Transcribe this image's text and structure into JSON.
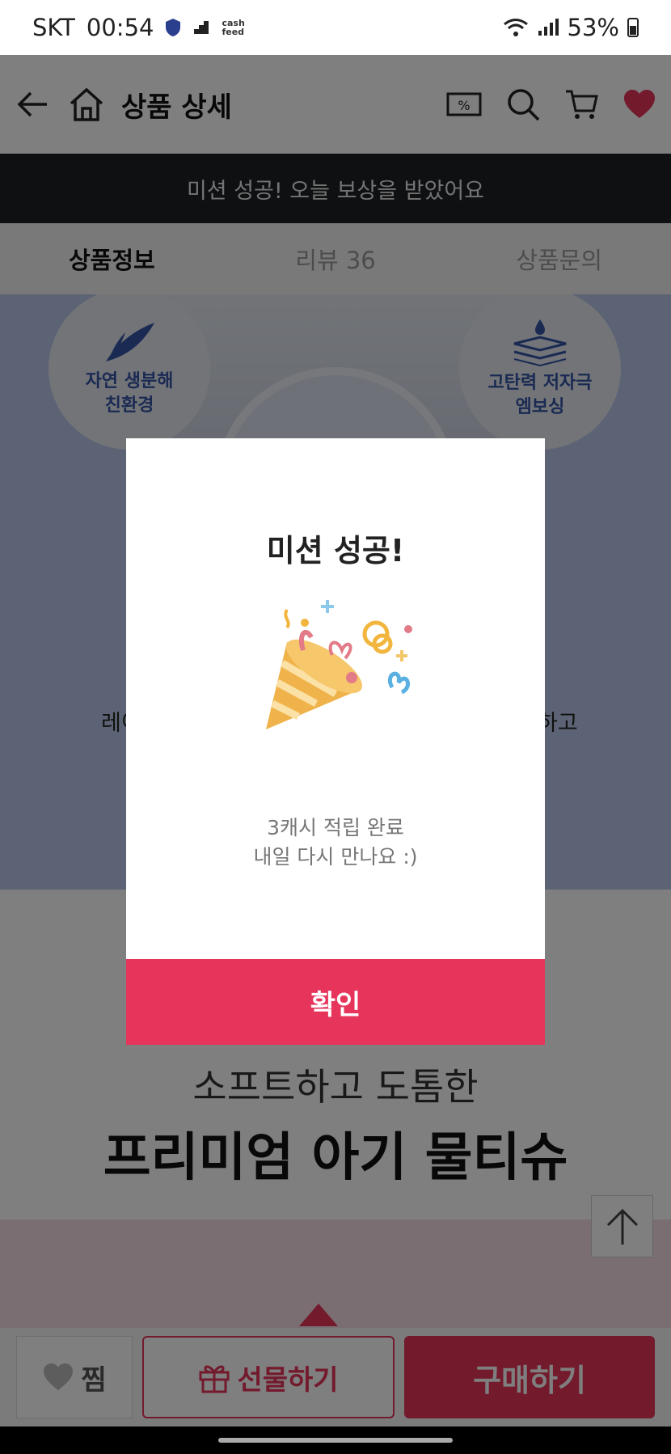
{
  "status_bar": {
    "carrier": "SKT",
    "time": "00:54",
    "cash_logo_top": "cash",
    "cash_logo_bottom": "feed",
    "battery": "53%"
  },
  "header": {
    "title": "상품 상세"
  },
  "banner": {
    "text": "미션 성공! 오늘 보상을 받았어요"
  },
  "tabs": [
    {
      "label": "상품정보"
    },
    {
      "label": "리뷰 36"
    },
    {
      "label": "상품문의"
    }
  ],
  "features": [
    {
      "label_line1": "자연 생분해",
      "label_line2": "친환경"
    },
    {
      "label_line1": "고탄력 저자극",
      "label_line2": "엠보싱"
    }
  ],
  "hero_caption": {
    "left": "레이",
    "right": "하고"
  },
  "headline": {
    "subtitle": "소프트하고 도톰한",
    "title": "프리미엄 아기 물티슈"
  },
  "bottom_bar": {
    "wish_label": "찜",
    "gift_label": "선물하기",
    "buy_label": "구매하기"
  },
  "dialog": {
    "title": "미션 성공!",
    "message_line1": "3캐시 적립 완료",
    "message_line2": "내일 다시 만나요 :)",
    "confirm_label": "확인"
  },
  "colors": {
    "accent": "#e6345a",
    "banner_bg": "#1f2124",
    "hero_bg": "#b9c7e8"
  }
}
